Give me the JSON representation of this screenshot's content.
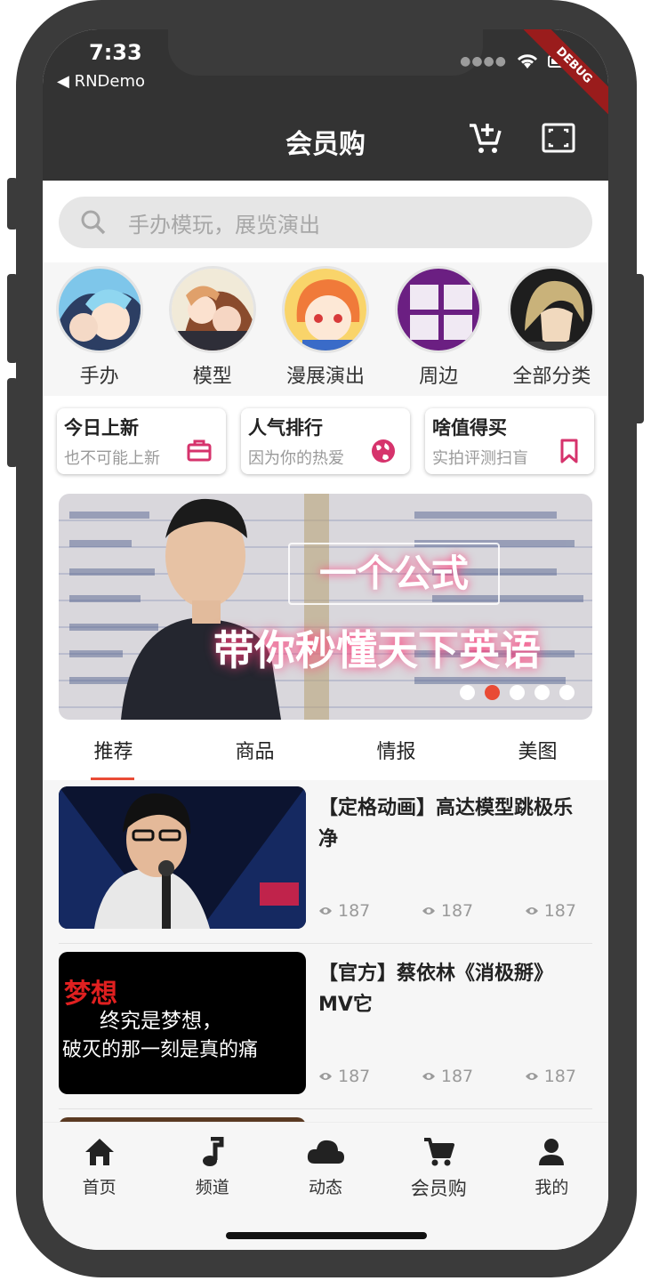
{
  "status_bar": {
    "time": "7:33",
    "back_app": "◀ RNDemo",
    "debug_label": "DEBUG"
  },
  "header": {
    "title": "会员购",
    "cart_icon": "add-cart-icon",
    "scan_icon": "scan-icon"
  },
  "search": {
    "placeholder": "手办模玩，展览演出",
    "icon": "search-icon"
  },
  "categories": [
    {
      "label": "手办"
    },
    {
      "label": "模型"
    },
    {
      "label": "漫展演出"
    },
    {
      "label": "周边"
    },
    {
      "label": "全部分类"
    }
  ],
  "feature_cards": [
    {
      "title": "今日上新",
      "subtitle": "也不可能上新",
      "icon": "briefcase-icon"
    },
    {
      "title": "人气排行",
      "subtitle": "因为你的热爱",
      "icon": "globe-icon"
    },
    {
      "title": "啥值得买",
      "subtitle": "实拍评测扫盲",
      "icon": "bookmark-icon"
    }
  ],
  "banner": {
    "line1": "一个公式",
    "line2": "带你秒懂天下英语",
    "dots": 5,
    "active_dot": 2
  },
  "tabs": [
    "推荐",
    "商品",
    "情报",
    "美图"
  ],
  "active_tab": 0,
  "feed": [
    {
      "title": "【定格动画】高达模型跳极乐净",
      "views": [
        "187",
        "187",
        "187"
      ]
    },
    {
      "title": "【官方】蔡依林《消极掰》MV它",
      "views": [
        "187",
        "187",
        "187"
      ],
      "thumb_lines": [
        "梦想",
        "终究是梦想，",
        "破灭的那一刻是真的痛"
      ]
    }
  ],
  "bottom_nav": [
    {
      "label": "首页",
      "icon": "home-icon"
    },
    {
      "label": "频道",
      "icon": "music-note-icon"
    },
    {
      "label": "动态",
      "icon": "cloud-icon"
    },
    {
      "label": "会员购",
      "icon": "cart-icon"
    },
    {
      "label": "我的",
      "icon": "user-icon"
    }
  ],
  "colors": {
    "accent": "#e94b35",
    "header_bg": "#333333",
    "card_icon": "#d6336c"
  }
}
